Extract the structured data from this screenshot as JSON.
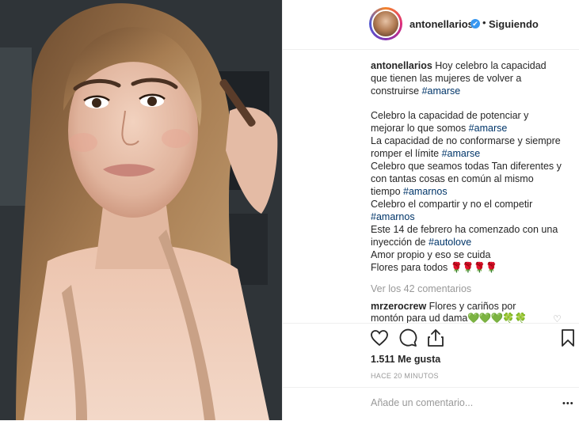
{
  "header": {
    "username": "antonellarios",
    "verified_glyph": "✔",
    "separator": "•",
    "follow_status": "Siguiendo"
  },
  "caption": {
    "author": "antonellarios",
    "line1_text": " Hoy celebro la capacidad",
    "line2": "que tienen las mujeres de volver a",
    "line3_text": "construirse ",
    "line3_tag": "#amarse",
    "p2_line1": "Celebro la capacidad de potenciar y",
    "p2_line2_text": "mejorar lo que somos ",
    "p2_line2_tag": "#amarse",
    "p2_line3": "La capacidad de no conformarse y siempre",
    "p2_line4_text": "romper el límite ",
    "p2_line4_tag": "#amarse",
    "p2_line5": "Celebro que seamos todas Tan diferentes y",
    "p2_line6": "con tantas cosas en común al mismo",
    "p2_line7_text": "tiempo ",
    "p2_line7_tag": "#amarnos",
    "p2_line8": "Celebro el compartir y no el competir",
    "p2_line9_tag": "#amarnos",
    "p2_line10": "Este 14 de febrero ha comenzado con una",
    "p2_line11_text": "inyección de ",
    "p2_line11_tag": "#autolove",
    "p2_line12": "Amor propio y eso se cuida",
    "p2_line13_text": "Flores para todos ",
    "p2_line13_emoji": "🌹🌹🌹🌹"
  },
  "comments": {
    "view_all": "Ver los 42 comentarios",
    "first": {
      "author": "mrzerocrew",
      "line1_text": " Flores y cariños por",
      "line2_text": "montón para ud dama",
      "line2_emoji": "💚💚💚",
      "line2_emoji2": "🍀🍀"
    }
  },
  "actions": {
    "like_icon": "heart-icon",
    "comment_icon": "comment-icon",
    "share_icon": "share-icon",
    "save_icon": "bookmark-icon"
  },
  "likes": "1.511 Me gusta",
  "timestamp": "HACE 20 MINUTOS",
  "comment_box": {
    "placeholder": "Añade un comentario...",
    "more": "•••"
  },
  "colors": {
    "link": "#003569",
    "verified": "#3897f0",
    "muted": "#999999"
  }
}
